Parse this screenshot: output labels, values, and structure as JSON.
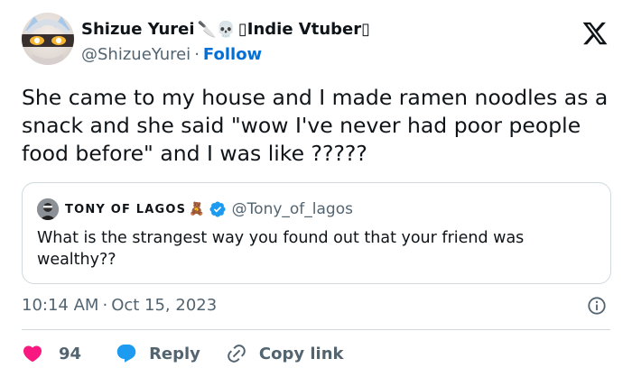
{
  "author": {
    "display_name": "Shizue Yurei",
    "name_emoji": "🔪💀",
    "name_tag": "▯Indie Vtuber▯",
    "handle": "@ShizueYurei",
    "separator": "·",
    "follow_label": "Follow",
    "avatar_icon": "anime-character-avatar"
  },
  "platform_icon": "x-logo-icon",
  "tweet": {
    "text": "She came to my house and I made ramen noodles as a snack and she said \"wow I've never had poor people food before\" and I was like ?????"
  },
  "quoted_tweet": {
    "display_name": "TONY OF LAGOS",
    "name_emoji": "🧸",
    "handle": "@Tony_of_lagos",
    "text": "What is the strangest way you found out that your friend was wealthy??",
    "verified_icon": "verified-badge-icon"
  },
  "meta": {
    "time": "10:14 AM",
    "separator": "·",
    "date": "Oct 15, 2023"
  },
  "actions": {
    "like_count": "94",
    "reply_label": "Reply",
    "copy_link_label": "Copy link"
  },
  "colors": {
    "like": "#f91880",
    "reply": "#1d9bf0",
    "link": "#006fd6",
    "verified": "#1d9bf0",
    "secondary_text": "#536471",
    "border": "#cfd9de"
  }
}
